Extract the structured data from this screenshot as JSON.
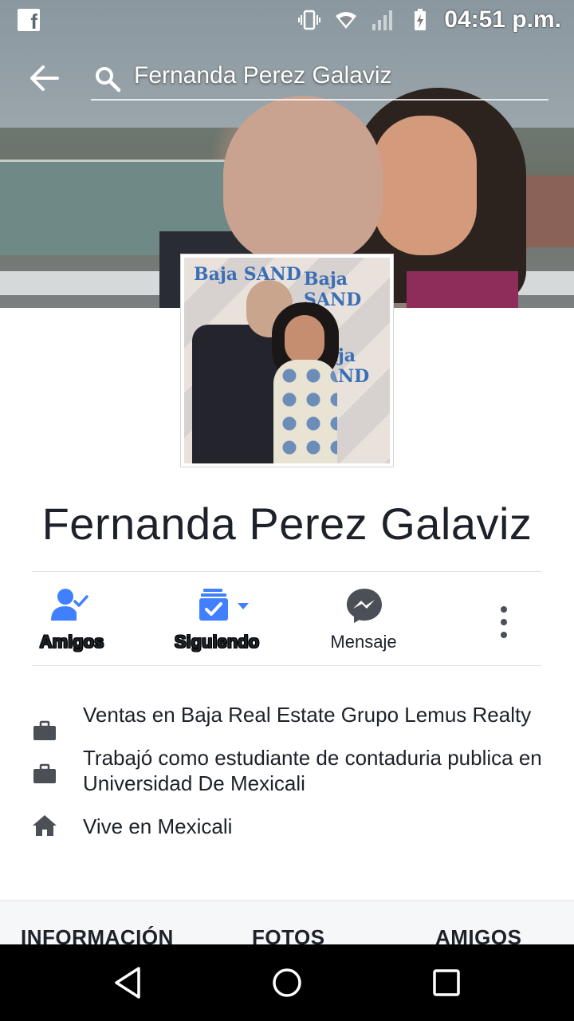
{
  "status_bar": {
    "time": "04:51 p.m.",
    "icons": [
      "facebook-icon",
      "vibrate-icon",
      "wifi-icon",
      "signal-icon",
      "battery-charging-icon"
    ]
  },
  "search": {
    "query": "Fernanda Perez Galaviz"
  },
  "profile": {
    "name": "Fernanda Perez Galaviz",
    "photo_logo_text": "Baja SAND"
  },
  "actions": {
    "friends_label": "Amigos",
    "following_label": "Siguiendo",
    "message_label": "Mensaje"
  },
  "info": [
    {
      "icon": "briefcase-icon",
      "text": "Ventas en Baja Real Estate Grupo Lemus Realty"
    },
    {
      "icon": "briefcase-icon",
      "text": "Trabajó como estudiante de contaduria publica en Universidad De Mexicali"
    },
    {
      "icon": "home-icon",
      "text": "Vive en Mexicali"
    }
  ],
  "tabs": {
    "info": "INFORMACIÓN",
    "photos": "FOTOS",
    "friends": "AMIGOS"
  },
  "colors": {
    "facebook_blue": "#4080ff",
    "messenger_gray": "#4b4f56",
    "text": "#1d2129"
  }
}
